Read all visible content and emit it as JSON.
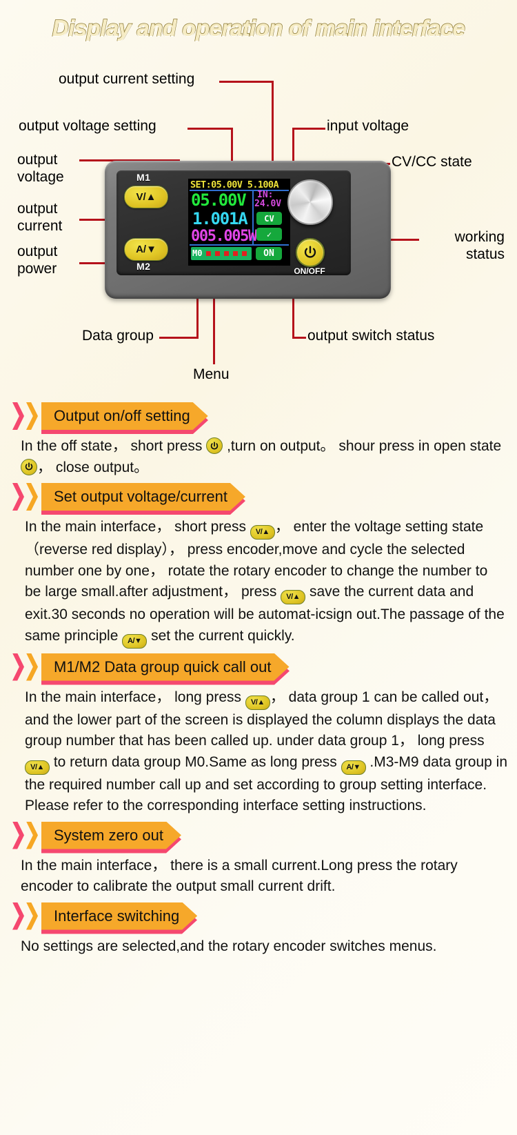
{
  "title": "Display and operation of main interface",
  "diagram": {
    "callouts": [
      {
        "id": "output-current-setting",
        "label": "output current setting"
      },
      {
        "id": "output-voltage-setting",
        "label": "output voltage setting"
      },
      {
        "id": "input-voltage",
        "label": "input voltage"
      },
      {
        "id": "output-voltage",
        "label": "output\nvoltage"
      },
      {
        "id": "cv-cc-state",
        "label": "CV/CC state"
      },
      {
        "id": "output-current",
        "label": "output\ncurrent"
      },
      {
        "id": "working-status",
        "label": "working\nstatus"
      },
      {
        "id": "output-power",
        "label": "output\npower"
      },
      {
        "id": "data-group",
        "label": "Data group"
      },
      {
        "id": "output-switch-status",
        "label": "output switch status"
      },
      {
        "id": "menu",
        "label": "Menu"
      }
    ],
    "labels": {
      "output_current_setting": "output current setting",
      "output_voltage_setting": "output voltage setting",
      "input_voltage": "input voltage",
      "output_voltage_l1": "output",
      "output_voltage_l2": "voltage",
      "cv_cc_state": "CV/CC state",
      "output_current_l1": "output",
      "output_current_l2": "current",
      "working_status_l1": "working",
      "working_status_l2": "status",
      "output_power_l1": "output",
      "output_power_l2": "power",
      "data_group": "Data group",
      "output_switch_status": "output switch status",
      "menu": "Menu"
    },
    "device": {
      "m1_label": "M1",
      "m2_label": "M2",
      "v_button": "V/",
      "a_button": "A/",
      "onoff_label": "ON/OFF",
      "lcd": {
        "set_line": "SET:05.00V 5.100A",
        "voltage": "05.00V",
        "current": "1.001A",
        "power": "005.005W",
        "input_label": "IN:",
        "input_value": "24.0V",
        "cv_badge": "CV",
        "check_badge": "✓",
        "on_badge": "ON",
        "group_label": "M0",
        "group_squares": 5
      }
    }
  },
  "sections": [
    {
      "id": "output-onoff-setting",
      "heading": "Output on/off setting",
      "paragraph_parts": [
        {
          "t": "text",
          "v": "In the off state，  short press "
        },
        {
          "t": "power-key"
        },
        {
          "t": "text",
          "v": " ,turn on output。 shour press in open state "
        },
        {
          "t": "power-key"
        },
        {
          "t": "text",
          "v": "，  close output。"
        }
      ]
    },
    {
      "id": "set-output-voltage-current",
      "heading": "Set output voltage/current",
      "paragraph_parts": [
        {
          "t": "text",
          "v": "In the main interface，  short press "
        },
        {
          "t": "v-key"
        },
        {
          "t": "text",
          "v": "，  enter the voltage setting state（reverse red display），  press encoder,move and cycle the selected number one by one，  rotate the rotary encoder to change the number to be large small.after adjustment，  press "
        },
        {
          "t": "v-key"
        },
        {
          "t": "text",
          "v": " save the current data and exit.30 seconds no operation will be automat-icsign out.The passage of the same principle "
        },
        {
          "t": "a-key"
        },
        {
          "t": "text",
          "v": " set the current quickly."
        }
      ]
    },
    {
      "id": "m1-m2-data-group-quick-call-out",
      "heading": "M1/M2 Data group quick call out",
      "paragraph_parts": [
        {
          "t": "text",
          "v": "In the main interface，  long press "
        },
        {
          "t": "v-key"
        },
        {
          "t": "text",
          "v": "，  data group 1 can be called out，  and the lower part of the screen is displayed the column displays the data group number that has been called up. under data group 1，  long press "
        },
        {
          "t": "v-key"
        },
        {
          "t": "text",
          "v": " to return data group M0.Same as long press "
        },
        {
          "t": "a-key"
        },
        {
          "t": "text",
          "v": " .M3-M9 data group in the required number call up and set according to group setting interface. Please refer to the corresponding interface setting instructions."
        }
      ]
    },
    {
      "id": "system-zero-out",
      "heading": "System zero out",
      "paragraph_parts": [
        {
          "t": "text",
          "v": "In the main interface，  there is a small current.Long press the rotary encoder to calibrate the output small current drift."
        }
      ]
    },
    {
      "id": "interface-switching",
      "heading": "Interface switching",
      "paragraph_parts": [
        {
          "t": "text",
          "v": "No settings are selected,and the rotary encoder switches menus."
        }
      ]
    }
  ],
  "colors": {
    "background": "#fdfaf0",
    "title_fill": "#f6ecc4",
    "title_stroke": "#8d7a33",
    "banner_orange": "#f6a82a",
    "banner_pink": "#f5486f",
    "callout_red": "#b5121b",
    "lcd_voltage_green": "#22e83c",
    "lcd_current_cyan": "#35d8f2",
    "lcd_power_magenta": "#e246e8",
    "lcd_set_yellow": "#ece23a",
    "lcd_badge_green": "#15a83c",
    "button_yellow": "#e0c524"
  }
}
